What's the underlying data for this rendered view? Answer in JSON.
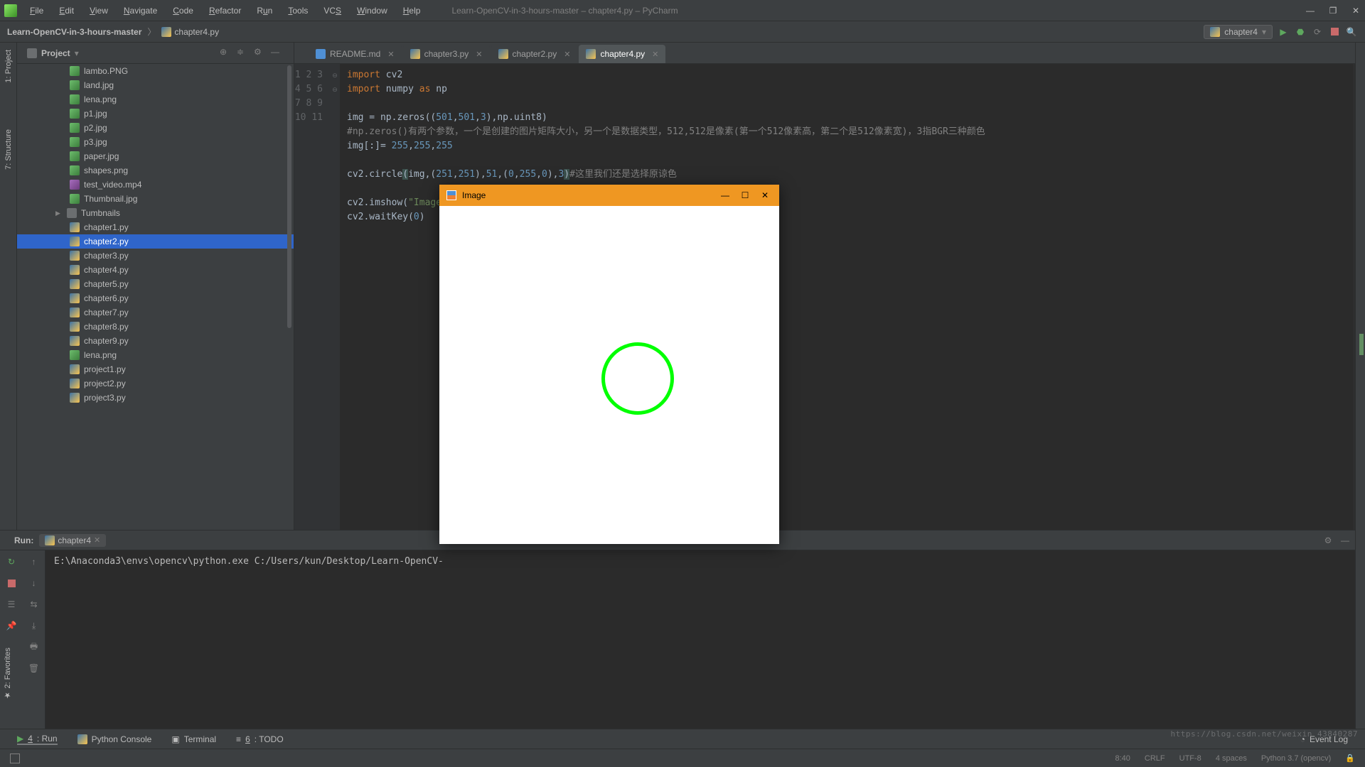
{
  "window_title": "Learn-OpenCV-in-3-hours-master – chapter4.py – PyCharm",
  "menu": [
    "File",
    "Edit",
    "View",
    "Navigate",
    "Code",
    "Refactor",
    "Run",
    "Tools",
    "VCS",
    "Window",
    "Help"
  ],
  "breadcrumb": {
    "project": "Learn-OpenCV-in-3-hours-master",
    "file": "chapter4.py"
  },
  "run_config": "chapter4",
  "sidebar": {
    "title": "Project",
    "tree": [
      {
        "type": "img",
        "name": "lambo.PNG"
      },
      {
        "type": "img",
        "name": "land.jpg"
      },
      {
        "type": "img",
        "name": "lena.png"
      },
      {
        "type": "img",
        "name": "p1.jpg"
      },
      {
        "type": "img",
        "name": "p2.jpg"
      },
      {
        "type": "img",
        "name": "p3.jpg"
      },
      {
        "type": "img",
        "name": "paper.jpg"
      },
      {
        "type": "img",
        "name": "shapes.png"
      },
      {
        "type": "vid",
        "name": "test_video.mp4"
      },
      {
        "type": "img",
        "name": "Thumbnail.jpg"
      },
      {
        "type": "fold",
        "name": "Tumbnails",
        "folder": true
      },
      {
        "type": "py",
        "name": "chapter1.py"
      },
      {
        "type": "py",
        "name": "chapter2.py",
        "selected": true
      },
      {
        "type": "py",
        "name": "chapter3.py"
      },
      {
        "type": "py",
        "name": "chapter4.py"
      },
      {
        "type": "py",
        "name": "chapter5.py"
      },
      {
        "type": "py",
        "name": "chapter6.py"
      },
      {
        "type": "py",
        "name": "chapter7.py"
      },
      {
        "type": "py",
        "name": "chapter8.py"
      },
      {
        "type": "py",
        "name": "chapter9.py"
      },
      {
        "type": "img",
        "name": "lena.png"
      },
      {
        "type": "py",
        "name": "project1.py"
      },
      {
        "type": "py",
        "name": "project2.py"
      },
      {
        "type": "py",
        "name": "project3.py"
      }
    ]
  },
  "left_gutter_tabs": [
    "1: Project",
    "7: Structure"
  ],
  "bottom_left_tab": "2: Favorites",
  "tabs": [
    {
      "name": "README.md",
      "icon": "md"
    },
    {
      "name": "chapter3.py",
      "icon": "py"
    },
    {
      "name": "chapter2.py",
      "icon": "py"
    },
    {
      "name": "chapter4.py",
      "icon": "py",
      "active": true
    }
  ],
  "code": {
    "lines": [
      "1",
      "2",
      "3",
      "4",
      "5",
      "6",
      "7",
      "8",
      "9",
      "10",
      "11"
    ],
    "l1_p": [
      "import",
      " cv2"
    ],
    "l2_p": [
      "import",
      " numpy ",
      "as",
      " np"
    ],
    "l3": "",
    "l4_p": [
      "img = np.zeros((",
      "501",
      ",",
      "501",
      ",",
      "3",
      "),np.uint8)"
    ],
    "l5_c": "#np.zeros()有两个参数，一个是创建的图片矩阵大小，另一个是数据类型，512,512是像素(第一个512像素高，第二个是512像素宽)，3指BGR三种颜色",
    "l6_p": [
      "img[:]= ",
      "255",
      ",",
      "255",
      ",",
      "255"
    ],
    "l7": "",
    "l8_p": [
      "cv2.circle",
      "(",
      "img,(",
      "251",
      ",",
      "251",
      "),",
      "51",
      ",(",
      "0",
      ",",
      "255",
      ",",
      "0",
      "),",
      "3",
      ")"
    ],
    "l8_c": "#这里我们还是选择原谅色",
    "l9": "",
    "l10_p": [
      "cv2.imshow(",
      "\"Image\"",
      ","
    ],
    "l11_p": [
      "cv2.waitKey(",
      "0",
      ")"
    ]
  },
  "console": {
    "header": "Run:",
    "tab": "chapter4",
    "output": "E:\\Anaconda3\\envs\\opencv\\python.exe C:/Users/kun/Desktop/Learn-OpenCV-"
  },
  "toolstrip": [
    {
      "label": "4: Run",
      "active": true,
      "u": "4"
    },
    {
      "label": "Python Console"
    },
    {
      "label": "Terminal"
    },
    {
      "label": "6: TODO",
      "u": "6"
    }
  ],
  "event_log": "Event Log",
  "status": {
    "pos": "8:40",
    "eol": "CRLF",
    "enc": "UTF-8",
    "indent": "4 spaces",
    "interp": "Python 3.7 (opencv)"
  },
  "image_window": {
    "title": "Image"
  },
  "watermark": "https://blog.csdn.net/weixin_43840287"
}
